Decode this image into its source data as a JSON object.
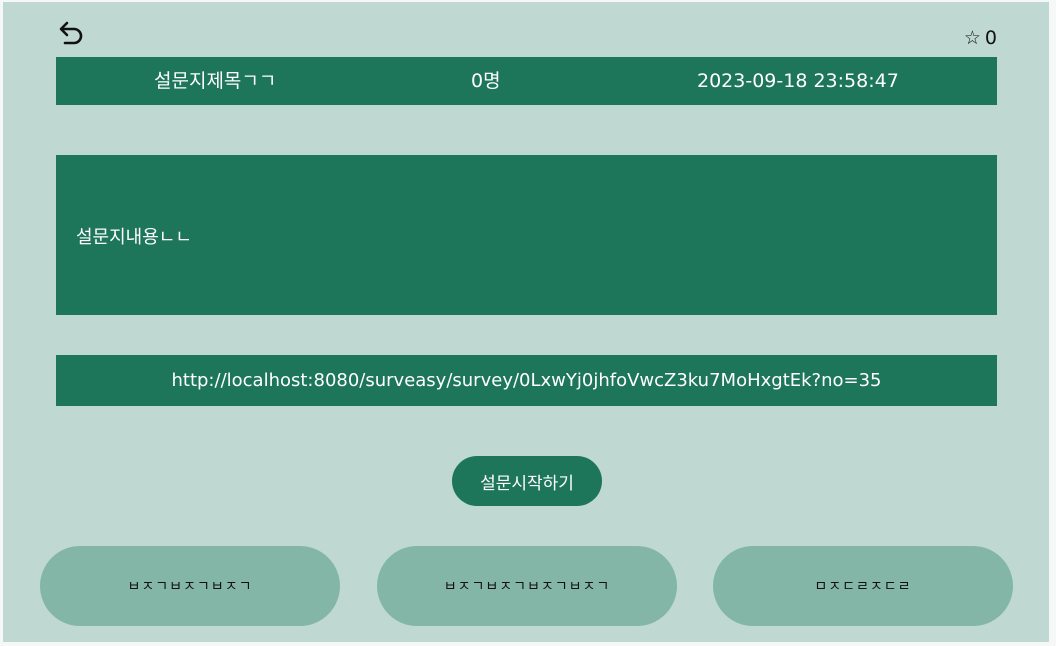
{
  "header": {
    "back_icon": "undo-arrow-icon",
    "star_icon": "star-outline-icon",
    "star_symbol": "☆",
    "star_count": "0"
  },
  "survey": {
    "title": "설문지제목ㄱㄱ",
    "participants": "0명",
    "created_at": "2023-09-18 23:58:47",
    "content": "설문지내용ㄴㄴ",
    "url": "http://localhost:8080/surveasy/survey/0LxwYj0jhfoVwcZ3ku7MoHxgtEk?no=35"
  },
  "actions": {
    "start_label": "설문시작하기",
    "button_1_label": "ㅂㅈㄱㅂㅈㄱㅂㅈㄱ",
    "button_2_label": "ㅂㅈㄱㅂㅈㄱㅂㅈㄱㅂㅈㄱ",
    "button_3_label": "ㅁㅈㄷㄹㅈㄷㄹ"
  },
  "colors": {
    "page_background": "#bfd8d2",
    "primary_green": "#1d7659",
    "light_green_button": "#84b6a7",
    "text_on_primary": "#ffffff"
  }
}
